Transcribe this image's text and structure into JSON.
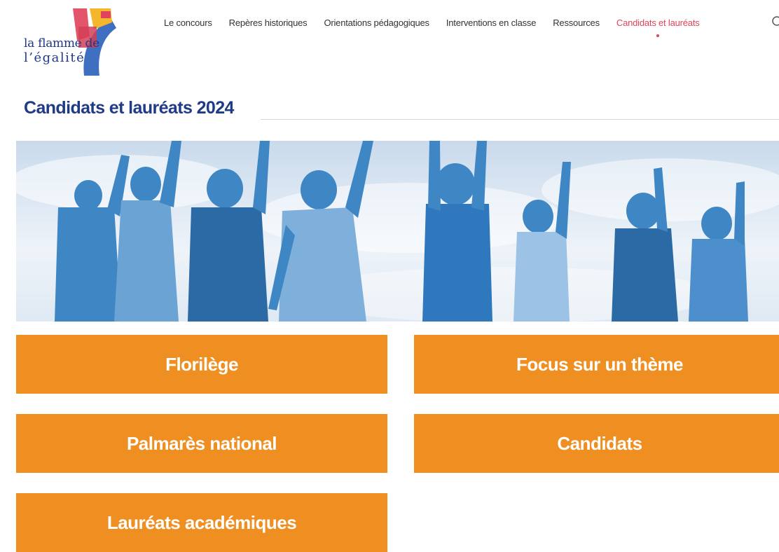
{
  "logo": {
    "line1": "la flamme de",
    "line2": "l’égalité"
  },
  "nav": {
    "items": [
      "Le concours",
      "Repères historiques",
      "Orientations pédagogiques",
      "Interventions en classe",
      "Ressources",
      "Candidats et lauréats"
    ],
    "active_index": 5
  },
  "search": {
    "icon": "search-icon"
  },
  "page": {
    "title": "Candidats et lauréats 2024"
  },
  "tiles": [
    "Florilège",
    "Focus sur un thème",
    "Palmarès national",
    "Candidats",
    "Lauréats académiques"
  ],
  "colors": {
    "brand_blue": "#1f3a86",
    "accent_red": "#e0435a",
    "tile_orange": "#ef8f22",
    "hero_blue": "#3e86c4"
  }
}
